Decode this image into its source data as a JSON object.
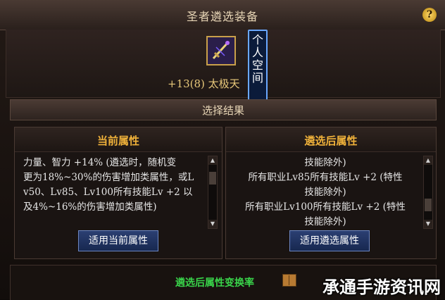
{
  "window": {
    "title": "圣者遴选装备"
  },
  "item": {
    "name": "+13(8) 太极天",
    "name_tail": "剑"
  },
  "tooltip": {
    "text": "个人空间"
  },
  "result_bar": {
    "label": "选择结果"
  },
  "current_attr": {
    "header": "当前属性",
    "lines": [
      "力量、智力 +14% (遴选时，随机变",
      "更为18%~30%的伤害增加类属性，或L",
      "v50、Lv85、Lv100所有技能Lv +2 以",
      "及4%~16%的伤害增加类属性)"
    ],
    "button": "适用当前属性"
  },
  "selected_attr": {
    "header": "遴选后属性",
    "lines": [
      "技能除外)",
      "所有职业Lv85所有技能Lv +2 (特性",
      "技能除外)",
      "所有职业Lv100所有技能Lv +2 (特性",
      "技能除外)"
    ],
    "button": "适用遴选属性"
  },
  "bottom": {
    "conversion_label": "遴选后属性变换率"
  },
  "watermark": {
    "text": "承通手游资讯网"
  },
  "icons": [
    "help-icon",
    "sword-item-icon",
    "book-icon",
    "scroll-up-icon",
    "scroll-down-icon"
  ]
}
